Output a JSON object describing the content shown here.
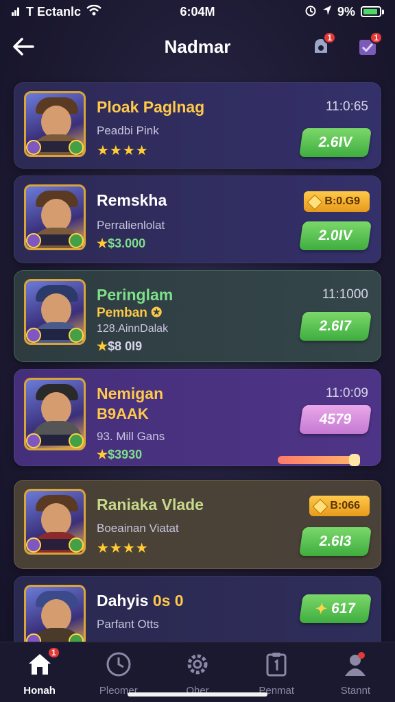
{
  "status_bar": {
    "carrier": "T Ectanlc",
    "time": "6:04M",
    "battery": "9%",
    "battery_level": 0.9
  },
  "header": {
    "title": "Nadmar",
    "bell_badge": "1",
    "task_badge": "1"
  },
  "cards": [
    {
      "name": "Ploak Paglnag",
      "sub": "Peadbi Pink",
      "stars": "★★★★",
      "time": "11:0:65",
      "button": "2.6IV"
    },
    {
      "name": "Remskha",
      "sub": "Perralienlolat",
      "amount": "$3.000",
      "tag": "B:0.G9",
      "button": "2.0IV"
    },
    {
      "name": "Peringlam",
      "name2": "Pemban",
      "sub": "128.AinnDalak",
      "amount": "$8 0I9",
      "time": "11:1000",
      "button": "2.6I7"
    },
    {
      "name": "Nemigan",
      "name2": "B9AAK",
      "sub": "93. Mill Gans",
      "amount": "$3930",
      "time": "11:0:09",
      "button": "4579",
      "progress": 0.95
    },
    {
      "name": "Raniaka Vlade",
      "sub": "Boeainan Viatat",
      "stars": "★★★★",
      "tag": "B:066",
      "button": "2.6I3"
    },
    {
      "name": "Dahyis",
      "name_suffix": "0s 0",
      "sub": "Parfant Otts",
      "button": "617"
    }
  ],
  "tabs": [
    {
      "label": "Honah",
      "icon": "home-icon",
      "badge": "1"
    },
    {
      "label": "Pleomer",
      "icon": "clock-icon"
    },
    {
      "label": "Oher",
      "icon": "gear-icon"
    },
    {
      "label": "Penmat",
      "icon": "clipboard-icon"
    },
    {
      "label": "Stannt",
      "icon": "profile-icon"
    }
  ]
}
